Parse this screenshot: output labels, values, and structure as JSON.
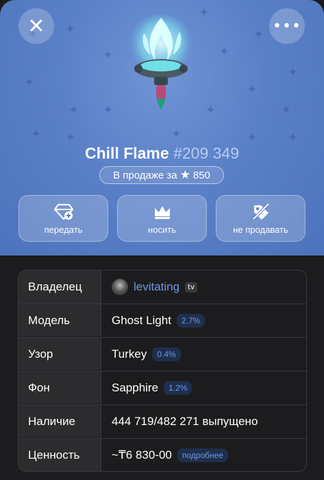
{
  "header": {
    "close_icon": "close-icon",
    "more_icon": "more-icon",
    "gift_name": "Chill Flame",
    "gift_number": "#209 349",
    "sale_prefix": "В продаже за",
    "star_glyph": "★",
    "sale_price": "850",
    "bg_color": "#5a80c7"
  },
  "actions": [
    {
      "label": "передать",
      "icon": "gift-transfer-icon"
    },
    {
      "label": "носить",
      "icon": "crown-icon"
    },
    {
      "label": "не продавать",
      "icon": "tag-off-icon"
    }
  ],
  "details": {
    "owner": {
      "key": "Владелец",
      "value": "levitating",
      "badge": "tv"
    },
    "model": {
      "key": "Модель",
      "value": "Ghost Light",
      "rarity": "2.7%"
    },
    "pattern": {
      "key": "Узор",
      "value": "Turkey",
      "rarity": "0.4%"
    },
    "backdrop": {
      "key": "Фон",
      "value": "Sapphire",
      "rarity": "1.2%"
    },
    "availability": {
      "key": "Наличие",
      "value": "444 719/482 271 выпущено"
    },
    "value": {
      "key": "Ценность",
      "value": "~₸6 830-00",
      "more": "подробнее"
    }
  }
}
